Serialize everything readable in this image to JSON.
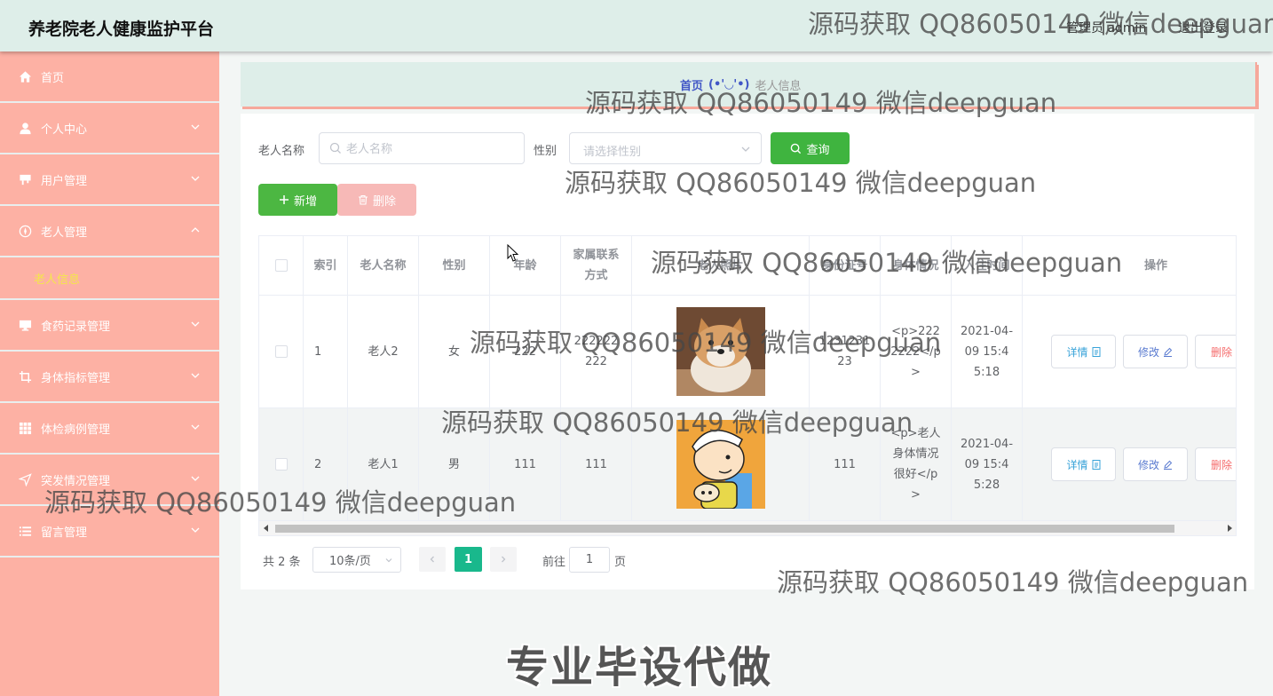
{
  "header": {
    "title": "养老院老人健康监护平台",
    "user": "管理员 admin",
    "logout": "退出登录"
  },
  "sidebar": {
    "items": [
      {
        "label": "首页",
        "icon": "home-icon",
        "expandable": false
      },
      {
        "label": "个人中心",
        "icon": "user-icon",
        "expandable": true
      },
      {
        "label": "用户管理",
        "icon": "board-icon",
        "expandable": true
      },
      {
        "label": "老人管理",
        "icon": "compass-icon",
        "expandable": true,
        "expanded": true,
        "children": [
          "老人信息"
        ]
      },
      {
        "label": "食药记录管理",
        "icon": "monitor-icon",
        "expandable": true
      },
      {
        "label": "身体指标管理",
        "icon": "crop-icon",
        "expandable": true
      },
      {
        "label": "体检病例管理",
        "icon": "grid-icon",
        "expandable": true
      },
      {
        "label": "突发情况管理",
        "icon": "send-icon",
        "expandable": true
      },
      {
        "label": "留言管理",
        "icon": "list-icon",
        "expandable": true
      }
    ]
  },
  "breadcrumb": {
    "home": "首页",
    "separator": "(•'◡'•)",
    "current": "老人信息"
  },
  "search": {
    "name_label": "老人名称",
    "name_placeholder": "老人名称",
    "name_value": "",
    "sex_label": "性别",
    "sex_placeholder": "请选择性别",
    "query_button": "查询"
  },
  "actions": {
    "add_button": "新增",
    "delete_button": "删除"
  },
  "table": {
    "columns": [
      "索引",
      "老人名称",
      "性别",
      "年龄",
      "家属联系方式",
      "老人照片",
      "身份证号",
      "身体情况",
      "入住时间",
      "操作"
    ],
    "rows": [
      {
        "index": "1",
        "name": "老人2",
        "sex": "女",
        "age": "222",
        "contact": "222222222",
        "photo": "shiba-dog-photo",
        "id_card": "123123123",
        "condition": "<p>2222222</p>",
        "checkin": "2021-04-09 15:45:18"
      },
      {
        "index": "2",
        "name": "老人1",
        "sex": "男",
        "age": "111",
        "contact": "111",
        "photo": "cartoon-boy-photo",
        "id_card": "111",
        "condition": "<p>老人身体情况很好</p>",
        "checkin": "2021-04-09 15:45:28"
      }
    ],
    "row_actions": {
      "detail": "详情",
      "edit": "修改",
      "delete": "删除"
    }
  },
  "pagination": {
    "total": "共 2 条",
    "page_size": "10条/页",
    "current_page": "1",
    "goto_prefix": "前往",
    "goto_value": "1",
    "goto_suffix": "页"
  },
  "watermarks": {
    "text": "源码获取 QQ86050149 微信deepguan",
    "banner": "专业毕设代做"
  },
  "colors": {
    "sidebar": "#fdb1a4",
    "header": "#deeee9",
    "primary_green": "#3fb43f",
    "page_active": "#19b88c",
    "submenu_active": "#f4e74a"
  }
}
